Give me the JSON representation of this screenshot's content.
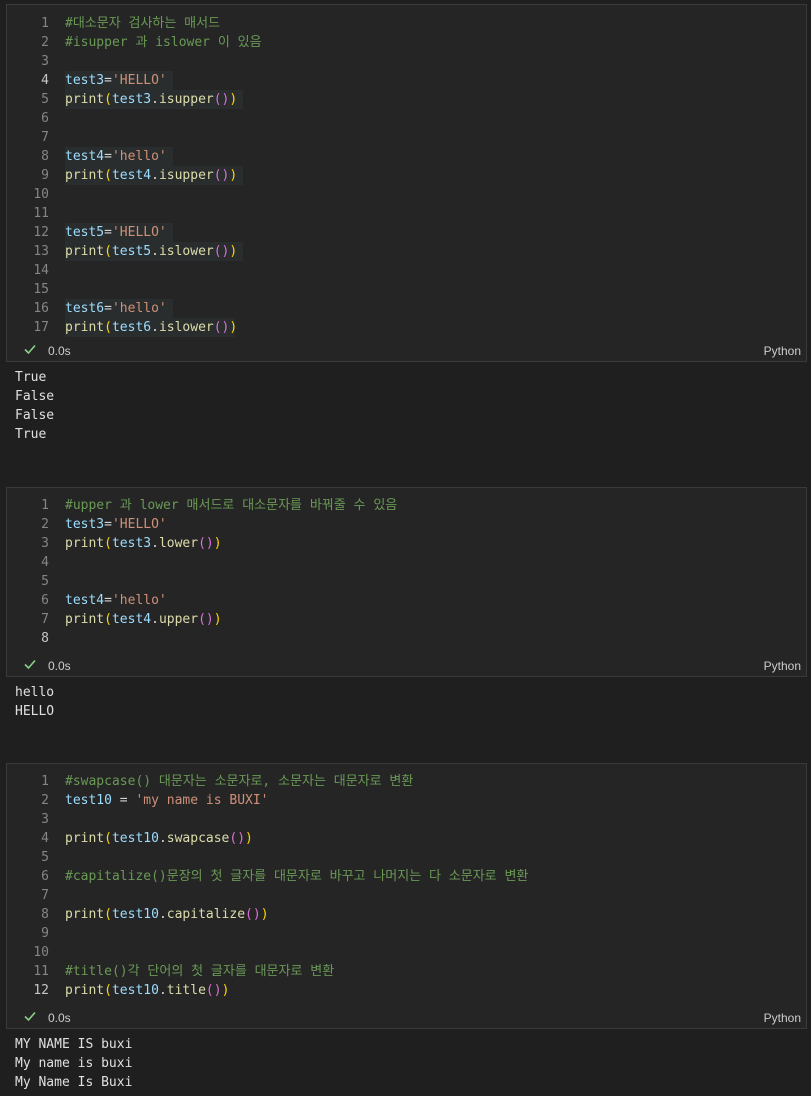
{
  "cells": [
    {
      "lines": [
        {
          "n": "1",
          "parts": [
            [
              "c",
              "#대소문자 검사하는 매서드"
            ]
          ]
        },
        {
          "n": "2",
          "parts": [
            [
              "c",
              "#isupper 과 islower 이 있음"
            ]
          ]
        },
        {
          "n": "3",
          "parts": []
        },
        {
          "n": "4",
          "parts": [
            [
              "v",
              "test3"
            ],
            [
              "op",
              "="
            ],
            [
              "s",
              "'HELLO'"
            ]
          ]
        },
        {
          "n": "5",
          "parts": [
            [
              "f",
              "print"
            ],
            [
              "pa",
              "("
            ],
            [
              "v",
              "test3"
            ],
            [
              "op",
              "."
            ],
            [
              "f",
              "isupper"
            ],
            [
              "pb",
              "()"
            ],
            [
              "pa",
              ")"
            ]
          ]
        },
        {
          "n": "6",
          "parts": []
        },
        {
          "n": "7",
          "parts": []
        },
        {
          "n": "8",
          "parts": [
            [
              "v",
              "test4"
            ],
            [
              "op",
              "="
            ],
            [
              "s",
              "'hello'"
            ]
          ]
        },
        {
          "n": "9",
          "parts": [
            [
              "f",
              "print"
            ],
            [
              "pa",
              "("
            ],
            [
              "v",
              "test4"
            ],
            [
              "op",
              "."
            ],
            [
              "f",
              "isupper"
            ],
            [
              "pb",
              "()"
            ],
            [
              "pa",
              ")"
            ]
          ]
        },
        {
          "n": "10",
          "parts": []
        },
        {
          "n": "11",
          "parts": []
        },
        {
          "n": "12",
          "parts": [
            [
              "v",
              "test5"
            ],
            [
              "op",
              "="
            ],
            [
              "s",
              "'HELLO'"
            ]
          ]
        },
        {
          "n": "13",
          "parts": [
            [
              "f",
              "print"
            ],
            [
              "pa",
              "("
            ],
            [
              "v",
              "test5"
            ],
            [
              "op",
              "."
            ],
            [
              "f",
              "islower"
            ],
            [
              "pb",
              "()"
            ],
            [
              "pa",
              ")"
            ]
          ]
        },
        {
          "n": "14",
          "parts": []
        },
        {
          "n": "15",
          "parts": []
        },
        {
          "n": "16",
          "parts": [
            [
              "v",
              "test6"
            ],
            [
              "op",
              "="
            ],
            [
              "s",
              "'hello'"
            ]
          ]
        },
        {
          "n": "17",
          "parts": [
            [
              "f",
              "print"
            ],
            [
              "pa",
              "("
            ],
            [
              "v",
              "test6"
            ],
            [
              "op",
              "."
            ],
            [
              "f",
              "islower"
            ],
            [
              "pb",
              "()"
            ],
            [
              "pa",
              ")"
            ]
          ]
        }
      ],
      "active_line": "4",
      "status": {
        "time": "0.0s",
        "language": "Python"
      },
      "output": [
        "True",
        "False",
        "False",
        "True"
      ]
    },
    {
      "lines": [
        {
          "n": "1",
          "parts": [
            [
              "c",
              "#upper 과 lower 매서드로 대소문자를 바꿔줄 수 있음"
            ]
          ]
        },
        {
          "n": "2",
          "parts": [
            [
              "v",
              "test3"
            ],
            [
              "op",
              "="
            ],
            [
              "s",
              "'HELLO'"
            ]
          ]
        },
        {
          "n": "3",
          "parts": [
            [
              "f",
              "print"
            ],
            [
              "pa",
              "("
            ],
            [
              "v",
              "test3"
            ],
            [
              "op",
              "."
            ],
            [
              "f",
              "lower"
            ],
            [
              "pb",
              "()"
            ],
            [
              "pa",
              ")"
            ]
          ]
        },
        {
          "n": "4",
          "parts": []
        },
        {
          "n": "5",
          "parts": []
        },
        {
          "n": "6",
          "parts": [
            [
              "v",
              "test4"
            ],
            [
              "op",
              "="
            ],
            [
              "s",
              "'hello'"
            ]
          ]
        },
        {
          "n": "7",
          "parts": [
            [
              "f",
              "print"
            ],
            [
              "pa",
              "("
            ],
            [
              "v",
              "test4"
            ],
            [
              "op",
              "."
            ],
            [
              "f",
              "upper"
            ],
            [
              "pb",
              "()"
            ],
            [
              "pa",
              ")"
            ]
          ]
        },
        {
          "n": "8",
          "parts": []
        }
      ],
      "active_line": "8",
      "status": {
        "time": "0.0s",
        "language": "Python"
      },
      "output": [
        "hello",
        "HELLO"
      ]
    },
    {
      "lines": [
        {
          "n": "1",
          "parts": [
            [
              "c",
              "#swapcase() 대문자는 소문자로, 소문자는 대문자로 변환"
            ]
          ]
        },
        {
          "n": "2",
          "parts": [
            [
              "v",
              "test10"
            ],
            [
              "op",
              " = "
            ],
            [
              "s",
              "'my name is BUXI'"
            ]
          ]
        },
        {
          "n": "3",
          "parts": []
        },
        {
          "n": "4",
          "parts": [
            [
              "f",
              "print"
            ],
            [
              "pa",
              "("
            ],
            [
              "v",
              "test10"
            ],
            [
              "op",
              "."
            ],
            [
              "f",
              "swapcase"
            ],
            [
              "pb",
              "()"
            ],
            [
              "pa",
              ")"
            ]
          ]
        },
        {
          "n": "5",
          "parts": []
        },
        {
          "n": "6",
          "parts": [
            [
              "c",
              "#capitalize()문장의 첫 글자를 대문자로 바꾸고 나머지는 다 소문자로 변환"
            ]
          ]
        },
        {
          "n": "7",
          "parts": []
        },
        {
          "n": "8",
          "parts": [
            [
              "f",
              "print"
            ],
            [
              "pa",
              "("
            ],
            [
              "v",
              "test10"
            ],
            [
              "op",
              "."
            ],
            [
              "f",
              "capitalize"
            ],
            [
              "pb",
              "()"
            ],
            [
              "pa",
              ")"
            ]
          ]
        },
        {
          "n": "9",
          "parts": []
        },
        {
          "n": "10",
          "parts": []
        },
        {
          "n": "11",
          "parts": [
            [
              "c",
              "#title()각 단어의 첫 글자를 대문자로 변환"
            ]
          ]
        },
        {
          "n": "12",
          "parts": [
            [
              "f",
              "print"
            ],
            [
              "pa",
              "("
            ],
            [
              "v",
              "test10"
            ],
            [
              "op",
              "."
            ],
            [
              "f",
              "title"
            ],
            [
              "pb",
              "()"
            ],
            [
              "pa",
              ")"
            ]
          ]
        }
      ],
      "active_line": "12",
      "status": {
        "time": "0.0s",
        "language": "Python"
      },
      "output": [
        "MY NAME IS buxi",
        "My name is buxi",
        "My Name Is Buxi"
      ]
    }
  ],
  "icons": {
    "status_check": "check-icon"
  },
  "colors": {
    "background": "#1f1f1f",
    "cell": "#252526",
    "success": "#89d185"
  }
}
